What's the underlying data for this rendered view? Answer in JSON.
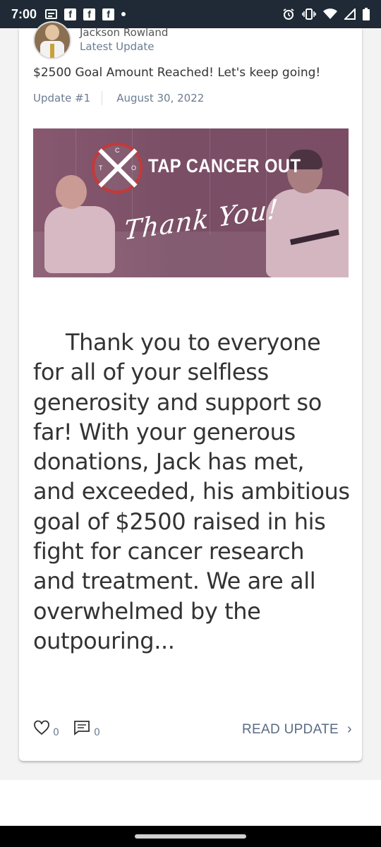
{
  "status_bar": {
    "time": "7:00",
    "left_icons": [
      "message-icon",
      "facebook-icon",
      "facebook-icon",
      "facebook-icon",
      "dot-icon"
    ],
    "right_icons": [
      "alarm-icon",
      "vibrate-icon",
      "wifi-icon",
      "signal-icon",
      "battery-icon"
    ]
  },
  "update": {
    "author_name": "Jackson Rowland",
    "author_subtitle": "Latest Update",
    "title": "$2500 Goal Amount Reached! Let's keep going!",
    "update_number": "Update #1",
    "date": "August 30, 2022",
    "banner": {
      "brand": "TAP CANCER OUT",
      "tagline": "Thank You!",
      "logo_letters": [
        "C",
        "T",
        "O"
      ]
    },
    "body": "Thank you to everyone for all of your selfless generosity and support so far! With your generous donations, Jack has met, and exceeded, his ambitious goal of $2500 raised in his fight for cancer research and treatment. We are all overwhelmed by the outpouring...",
    "likes": "0",
    "comments": "0",
    "read_more_label": "READ UPDATE"
  },
  "colors": {
    "status_bar": "#1f2a36",
    "muted_text": "#6b7c92",
    "banner": "#7a4f66",
    "logo_ring": "#c23a3a"
  }
}
